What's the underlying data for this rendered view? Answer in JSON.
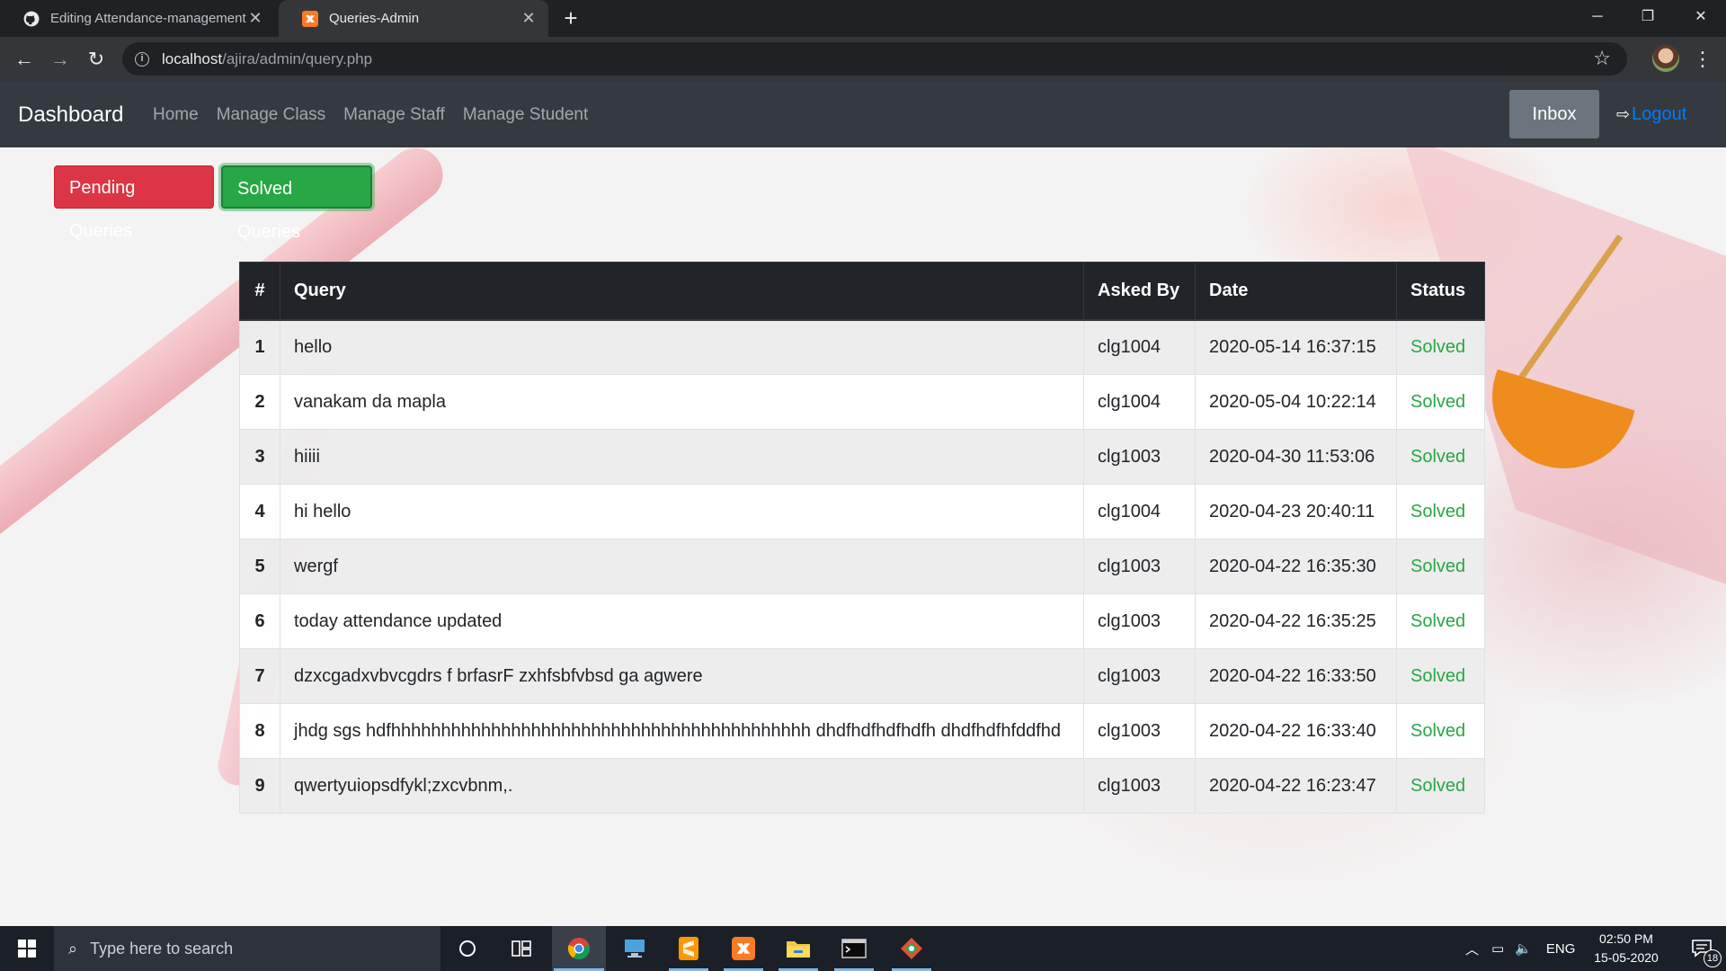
{
  "browser": {
    "tabs": [
      {
        "title": "Editing Attendance-management",
        "icon": "github-icon"
      },
      {
        "title": "Queries-Admin",
        "icon": "xampp-icon"
      }
    ],
    "url_host": "localhost",
    "url_path": "/ajira/admin/query.php"
  },
  "navbar": {
    "brand": "Dashboard",
    "links": [
      "Home",
      "Manage Class",
      "Manage Staff",
      "Manage Student"
    ],
    "inbox": "Inbox",
    "logout": "Logout"
  },
  "buttons": {
    "pending": "Pending Queries",
    "solved": "Solved Queries"
  },
  "table": {
    "headers": [
      "#",
      "Query",
      "Asked By",
      "Date",
      "Status"
    ],
    "rows": [
      [
        "1",
        "hello",
        "clg1004",
        "2020-05-14 16:37:15",
        "Solved"
      ],
      [
        "2",
        "vanakam da mapla",
        "clg1004",
        "2020-05-04 10:22:14",
        "Solved"
      ],
      [
        "3",
        "hiiii",
        "clg1003",
        "2020-04-30 11:53:06",
        "Solved"
      ],
      [
        "4",
        "hi hello",
        "clg1004",
        "2020-04-23 20:40:11",
        "Solved"
      ],
      [
        "5",
        "wergf",
        "clg1003",
        "2020-04-22 16:35:30",
        "Solved"
      ],
      [
        "6",
        "today attendance updated",
        "clg1003",
        "2020-04-22 16:35:25",
        "Solved"
      ],
      [
        "7",
        "dzxcgadxvbvcgdrs f brfasrF zxhfsbfvbsd ga agwere",
        "clg1003",
        "2020-04-22 16:33:50",
        "Solved"
      ],
      [
        "8",
        "jhdg sgs hdfhhhhhhhhhhhhhhhhhhhhhhhhhhhhhhhhhhhhhhhhhh dhdfhdfhdfhdfh dhdfhdfhfddfhd",
        "clg1003",
        "2020-04-22 16:33:40",
        "Solved"
      ],
      [
        "9",
        "qwertyuiopsdfykl;zxcvbnm,.",
        "clg1003",
        "2020-04-22 16:23:47",
        "Solved"
      ]
    ]
  },
  "taskbar": {
    "search_placeholder": "Type here to search",
    "language": "ENG",
    "time": "02:50 PM",
    "date": "15-05-2020",
    "notifications": "18"
  },
  "colors": {
    "danger": "#dc3545",
    "success": "#28a745",
    "navbar": "#343a40",
    "link": "#007bff"
  }
}
